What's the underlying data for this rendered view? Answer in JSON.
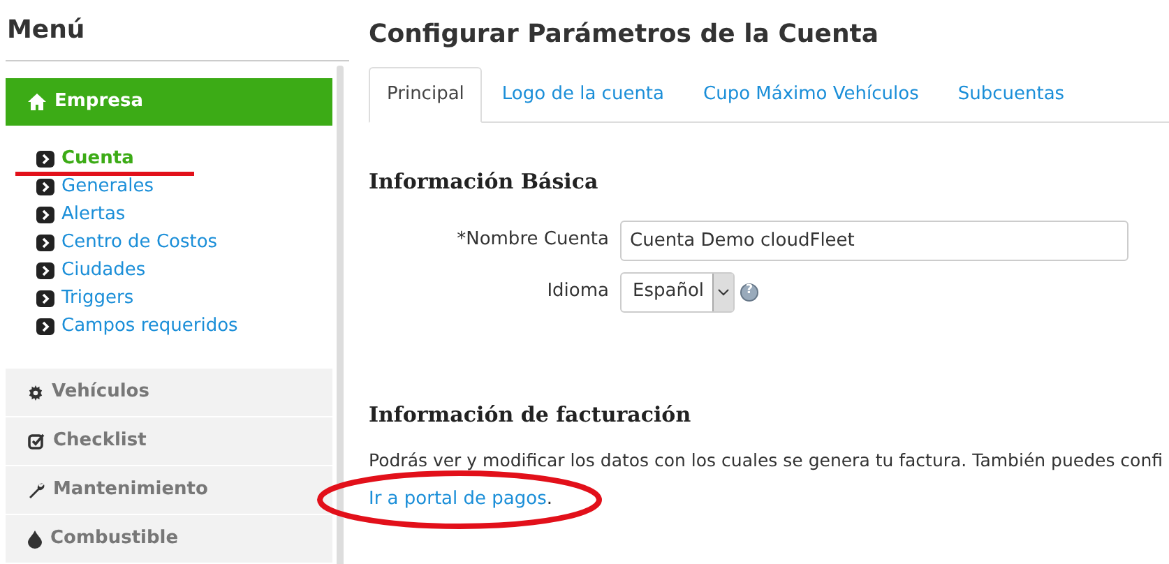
{
  "sidebar": {
    "title": "Menú",
    "sections": [
      {
        "label": "Empresa",
        "kind": "home",
        "expanded": true,
        "items": [
          {
            "label": "Cuenta",
            "selected": true
          },
          {
            "label": "Generales",
            "selected": false
          },
          {
            "label": "Alertas",
            "selected": false
          },
          {
            "label": "Centro de Costos",
            "selected": false
          },
          {
            "label": "Ciudades",
            "selected": false
          },
          {
            "label": "Triggers",
            "selected": false
          },
          {
            "label": "Campos requeridos",
            "selected": false
          }
        ]
      },
      {
        "label": "Vehículos",
        "kind": "gear",
        "expanded": false
      },
      {
        "label": "Checklist",
        "kind": "check",
        "expanded": false
      },
      {
        "label": "Mantenimiento",
        "kind": "wrench",
        "expanded": false
      },
      {
        "label": "Combustible",
        "kind": "drop",
        "expanded": false
      }
    ]
  },
  "page": {
    "title": "Configurar Parámetros de la Cuenta",
    "tabs": [
      {
        "label": "Principal",
        "selected": true
      },
      {
        "label": "Logo de la cuenta",
        "selected": false
      },
      {
        "label": "Cupo Máximo Vehículos",
        "selected": false
      },
      {
        "label": "Subcuentas",
        "selected": false
      }
    ],
    "basic": {
      "heading": "Información Básica",
      "fields": [
        {
          "kind": "text",
          "label": "*Nombre Cuenta",
          "value": "Cuenta Demo cloudFleet"
        },
        {
          "kind": "select",
          "label": "Idioma",
          "value": "Español",
          "help": "?"
        }
      ]
    },
    "billing": {
      "heading": "Información de facturación",
      "text": "Podrás ver y modificar los datos con los cuales se genera tu factura. También puedes confi",
      "link": "Ir a portal de pagos",
      "link_suffix": "."
    }
  }
}
